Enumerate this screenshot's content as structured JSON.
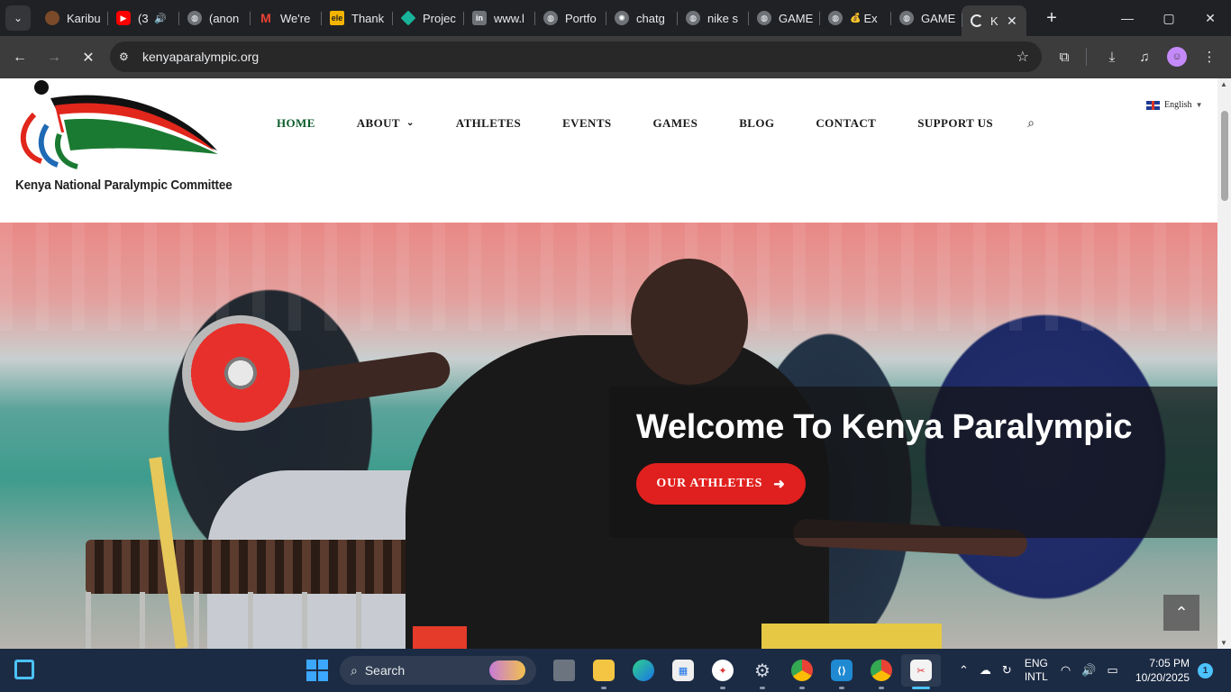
{
  "browser": {
    "tabs": [
      {
        "title": "Karibu",
        "favicon": "avatar-icon",
        "color": "#7a4a2a"
      },
      {
        "title": "(3",
        "favicon": "youtube-icon",
        "color": "#ff0000",
        "audio": "🔊"
      },
      {
        "title": "(anon",
        "favicon": "globe-icon",
        "color": "#6f7378"
      },
      {
        "title": "We're",
        "favicon": "gmail-icon",
        "color": "#ea4335"
      },
      {
        "title": "Thank",
        "favicon": "elementor-icon",
        "color": "#f2b400",
        "favtext": "ele"
      },
      {
        "title": "Projec",
        "favicon": "diamond-icon",
        "color": "#18b39a"
      },
      {
        "title": "www.l",
        "favicon": "linkedin-icon",
        "color": "#6f7378",
        "favtext": "in"
      },
      {
        "title": "Portfo",
        "favicon": "globe-icon",
        "color": "#6f7378"
      },
      {
        "title": "chatg",
        "favicon": "openai-icon",
        "color": "#6f7378"
      },
      {
        "title": "nike s",
        "favicon": "globe-icon",
        "color": "#6f7378"
      },
      {
        "title": "GAME",
        "favicon": "globe-icon",
        "color": "#6f7378"
      },
      {
        "title": "Ex",
        "favicon": "globe-icon",
        "color": "#6f7378",
        "emoji": "💰"
      },
      {
        "title": "GAME",
        "favicon": "globe-icon",
        "color": "#6f7378"
      }
    ],
    "active_tab": {
      "title": "K",
      "favicon": "loading-icon"
    },
    "new_tab": "+",
    "url": "kenyaparalympic.org",
    "window_controls": {
      "minimize": "—",
      "maximize": "▢",
      "close": "✕"
    }
  },
  "site": {
    "org_name": "Kenya National Paralympic Committee",
    "nav": [
      {
        "label": "HOME",
        "active": true
      },
      {
        "label": "ABOUT",
        "dropdown": true
      },
      {
        "label": "ATHLETES"
      },
      {
        "label": "EVENTS"
      },
      {
        "label": "GAMES"
      },
      {
        "label": "BLOG"
      },
      {
        "label": "CONTACT"
      },
      {
        "label": "SUPPORT US"
      }
    ],
    "language": "English",
    "hero": {
      "title": "Welcome To Kenya Paralympic",
      "button": "OUR ATHLETES"
    },
    "colors": {
      "brand_green": "#0b5c2a",
      "brand_red": "#e0201e",
      "brand_black": "#1a1a1a"
    }
  },
  "taskbar": {
    "search_label": "Search",
    "language_line1": "ENG",
    "language_line2": "INTL",
    "time": "7:05 PM",
    "date": "10/20/2025",
    "notifications": "1"
  }
}
